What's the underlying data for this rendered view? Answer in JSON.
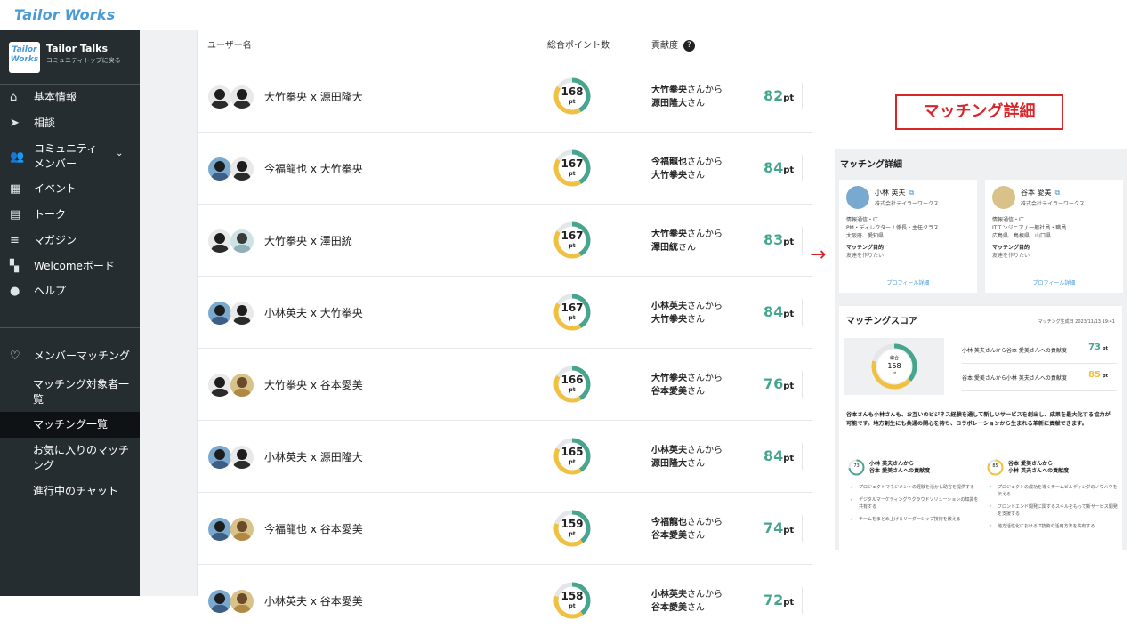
{
  "app": {
    "logo": "Tailor Works"
  },
  "sidebar": {
    "community_logo": "Tailor Works",
    "community_name": "Tailor Talks",
    "community_back": "コミュニティトップに戻る",
    "items": [
      {
        "icon": "home-icon",
        "label": "基本情報"
      },
      {
        "icon": "send-icon",
        "label": "相談"
      },
      {
        "icon": "people-icon",
        "label": "コミュニティメンバー"
      },
      {
        "icon": "calendar-icon",
        "label": "イベント"
      },
      {
        "icon": "chat-icon",
        "label": "トーク"
      },
      {
        "icon": "article-icon",
        "label": "マガジン"
      },
      {
        "icon": "dashboard-icon",
        "label": "Welcomeボード"
      },
      {
        "icon": "help-icon",
        "label": "ヘルプ"
      }
    ],
    "matching": {
      "label": "メンバーマッチング",
      "items": [
        {
          "label": "マッチング対象者一覧"
        },
        {
          "label": "マッチング一覧",
          "active": true
        },
        {
          "label": "お気に入りのマッチング"
        },
        {
          "label": "進行中のチャット"
        }
      ]
    }
  },
  "table": {
    "headers": {
      "user": "ユーザー名",
      "points": "総合ポイント数",
      "contribution": "貢献度"
    },
    "rows": [
      {
        "name": "大竹拳央 x 源田隆大",
        "points": 168,
        "pt": "pt",
        "from": "大竹拳央",
        "to": "源田隆大",
        "score": 82,
        "unit": "pt"
      },
      {
        "name": "今福龍也 x 大竹拳央",
        "points": 167,
        "pt": "pt",
        "from": "今福龍也",
        "to": "大竹拳央",
        "score": 84,
        "unit": "pt"
      },
      {
        "name": "大竹拳央 x 澤田統",
        "points": 167,
        "pt": "pt",
        "from": "大竹拳央",
        "to": "澤田統",
        "score": 83,
        "unit": "pt"
      },
      {
        "name": "小林英夫 x 大竹拳央",
        "points": 167,
        "pt": "pt",
        "from": "小林英夫",
        "to": "大竹拳央",
        "score": 84,
        "unit": "pt"
      },
      {
        "name": "大竹拳央 x 谷本愛美",
        "points": 166,
        "pt": "pt",
        "from": "大竹拳央",
        "to": "谷本愛美",
        "score": 76,
        "unit": "pt"
      },
      {
        "name": "小林英夫 x 源田隆大",
        "points": 165,
        "pt": "pt",
        "from": "小林英夫",
        "to": "源田隆大",
        "score": 84,
        "unit": "pt"
      },
      {
        "name": "今福龍也 x 谷本愛美",
        "points": 159,
        "pt": "pt",
        "from": "今福龍也",
        "to": "谷本愛美",
        "score": 74,
        "unit": "pt"
      },
      {
        "name": "小林英夫 x 谷本愛美",
        "points": 158,
        "pt": "pt",
        "from": "小林英夫",
        "to": "谷本愛美",
        "score": 72,
        "unit": "pt"
      }
    ],
    "from_suffix": "さんから",
    "to_suffix": "さん"
  },
  "annotation": {
    "title": "マッチング詳細",
    "arrow": "→"
  },
  "detail": {
    "title": "マッチング詳細",
    "cards": [
      {
        "name": "小林 英夫",
        "company": "株式会社テイラーワークス",
        "industry": "情報通信・IT",
        "role": "PM・ディレクター / 係長・主任クラス",
        "location": "大阪府、愛知県",
        "goal_label": "マッチング目的",
        "goal": "友達を作りたい",
        "link": "プロフィール詳細"
      },
      {
        "name": "谷本 愛美",
        "company": "株式会社テイラーワークス",
        "industry": "情報通信・IT",
        "role": "ITエンジニア / 一般社員・職員",
        "location": "広島県、島根県、山口県",
        "goal_label": "マッチング目的",
        "goal": "友達を作りたい",
        "link": "プロフィール詳細"
      }
    ],
    "score": {
      "title": "マッチングスコア",
      "date": "マッチング生成日 2023/11/13 19:41",
      "total_label": "総合",
      "total": "158",
      "total_unit": "pt",
      "rows": [
        {
          "label": "小林 英夫さんから谷本 愛美さんへの貢献度",
          "value": 73,
          "unit": "pt",
          "color": "#47a58f"
        },
        {
          "label": "谷本 愛美さんから小林 英夫さんへの貢献度",
          "value": 85,
          "unit": "pt",
          "color": "#f0c040"
        }
      ],
      "description": "谷本さんも小林さんも、お互いのビジネス経験を通して新しいサービスを創出し、成果を最大化する協力が可能です。地方創生にも共通の関心を持ち、コラボレーションから生まれる革新に貢献できます。",
      "columns": [
        {
          "value": 73,
          "title1": "小林 英夫さんから",
          "title2": "谷本 愛美さんへの貢献度",
          "color": "#47a58f",
          "items": [
            "プロジェクトマネジメントの経験を活かし助言を提供する",
            "デジタルマーケティングやクラウドソリューションの知識を共有する",
            "チームをまとめ上げるリーダーシップ技術を教える"
          ]
        },
        {
          "value": 85,
          "title1": "谷本 愛美さんから",
          "title2": "小林 英夫さんへの貢献度",
          "color": "#f0c040",
          "items": [
            "プロジェクトの成功を導くチームビルディングのノウハウを伝える",
            "フロントエンド開発に関するスキルをもって新サービス開発を支援する",
            "地方活性化におけるIT技術の活用方法を共有する"
          ]
        }
      ]
    }
  },
  "colors": {
    "accent_green": "#47a58f",
    "accent_yellow": "#f0c040",
    "sidebar_bg": "#262d30",
    "alert_red": "#d9252a"
  }
}
